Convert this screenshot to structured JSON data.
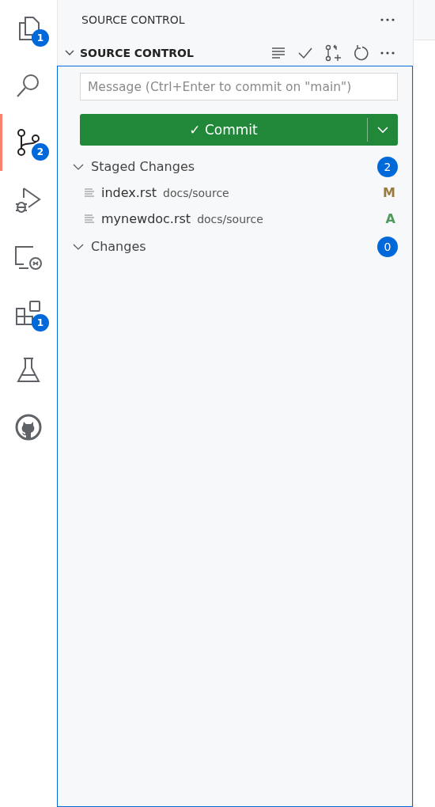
{
  "activity_bar": [
    {
      "kind": "files",
      "selected": false,
      "badge": "1"
    },
    {
      "kind": "search",
      "selected": false
    },
    {
      "kind": "source-control",
      "selected": true,
      "badge": "2"
    },
    {
      "kind": "run-debug",
      "selected": false
    },
    {
      "kind": "remote",
      "selected": false
    },
    {
      "kind": "extensions",
      "selected": false,
      "badge": "1"
    },
    {
      "kind": "testing",
      "selected": false
    },
    {
      "kind": "github",
      "selected": false
    }
  ],
  "sidebar": {
    "title": "SOURCE CONTROL",
    "section": {
      "title": "SOURCE CONTROL",
      "expanded": true,
      "message": {
        "placeholder": "Message (Ctrl+Enter to commit on \"main\")"
      },
      "commit_button": {
        "label": "✓ Commit"
      },
      "groups": [
        {
          "label": "Staged Changes",
          "count": "2",
          "expanded": true,
          "files": [
            {
              "name": "index.rst",
              "path": "docs/source",
              "status": "M",
              "color": "#9a7a3f"
            },
            {
              "name": "mynewdoc.rst",
              "path": "docs/source",
              "status": "A",
              "color": "#4f9a5e"
            }
          ]
        },
        {
          "label": "Changes",
          "count": "0",
          "expanded": true
        }
      ]
    }
  }
}
